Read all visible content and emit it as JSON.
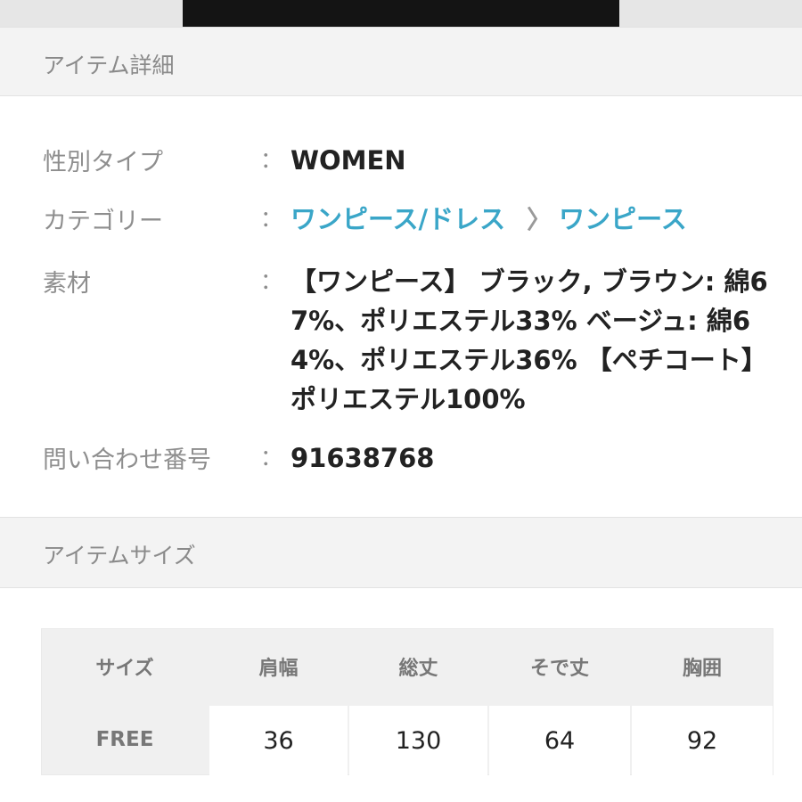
{
  "item_detail": {
    "section_title": "アイテム詳細",
    "rows": [
      {
        "label": "性別タイプ",
        "colon": "：",
        "value": "WOMEN"
      },
      {
        "label": "カテゴリー",
        "colon": "：",
        "breadcrumb": [
          "ワンピース/ドレス",
          "ワンピース"
        ],
        "separator": "〉"
      },
      {
        "label": "素材",
        "colon": "：",
        "value": "【ワンピース】 ブラック, ブラウン: 綿67%、ポリエステル33% ベージュ: 綿64%、ポリエステル36% 【ペチコート】 ポリエステル100%"
      },
      {
        "label": "問い合わせ番号",
        "colon": "：",
        "value": "91638768"
      }
    ],
    "link_color": "#3aa6c8"
  },
  "item_size": {
    "section_title": "アイテムサイズ",
    "table": {
      "headers": [
        "サイズ",
        "肩幅",
        "総丈",
        "そで丈",
        "胸囲"
      ],
      "rows": [
        {
          "size": "FREE",
          "values": [
            "36",
            "130",
            "64",
            "92"
          ]
        }
      ]
    }
  }
}
